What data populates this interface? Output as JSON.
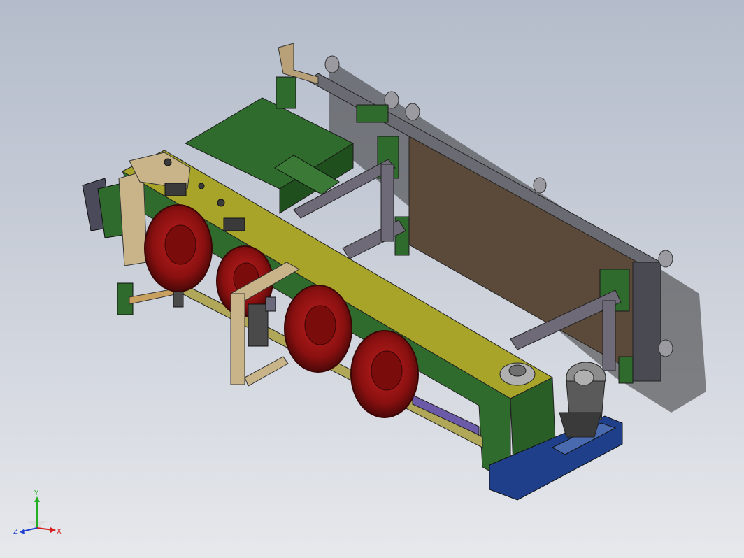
{
  "viewport": {
    "background_top": "#b4bccb",
    "background_bottom": "#e6e8ec"
  },
  "model": {
    "parts": {
      "frame_color": "#2f6b2c",
      "rail_color": "#a8a42a",
      "wheel_color": "#9a1818",
      "motor_color": "#8c8c8c",
      "base_color": "#1f3f8a",
      "panel_color": "#5b4a3a",
      "bar_color": "#6f6a78"
    }
  },
  "triad": {
    "x_label": "X",
    "y_label": "Y",
    "z_label": "Z",
    "x_color": "#d62020",
    "y_color": "#20b020",
    "z_color": "#2040d0"
  }
}
